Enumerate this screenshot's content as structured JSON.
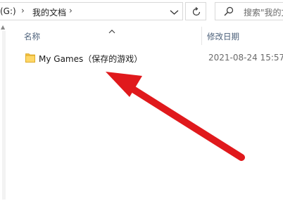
{
  "address_bar": {
    "drive_fragment": "(G:)",
    "current_folder": "我的文档",
    "separator": "›"
  },
  "search": {
    "placeholder": "搜索\"我的文"
  },
  "columns": {
    "name": "名称",
    "date_modified": "修改日期"
  },
  "files": [
    {
      "name": "My Games（保存的游戏）",
      "date_modified": "2021-08-24 15:57"
    }
  ],
  "colors": {
    "annotation_arrow": "#e0191c",
    "folder": "#f5c242",
    "header_text": "#4c607a"
  },
  "icons": [
    "chevron-down-icon",
    "refresh-icon",
    "search-icon",
    "folder-icon",
    "sort-ascending-icon",
    "annotation-arrow"
  ]
}
